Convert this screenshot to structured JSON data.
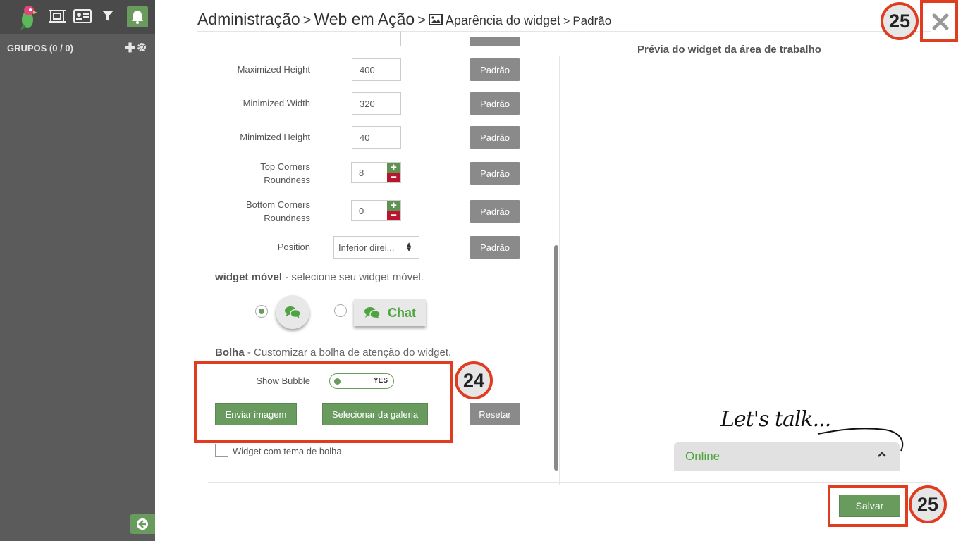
{
  "breadcrumb": {
    "admin": "Administração",
    "web_em_acao": "Web em Ação",
    "appearance": "Aparência do widget",
    "default": "Padrão",
    "sep": ">"
  },
  "sidebar": {
    "groups_label": "GRUPOS (0 / 0)"
  },
  "form": {
    "fields": [
      {
        "label": "Maximized Height",
        "value": "400",
        "button": "Padrão"
      },
      {
        "label": "Minimized Width",
        "value": "320",
        "button": "Padrão"
      },
      {
        "label": "Minimized Height",
        "value": "40",
        "button": "Padrão"
      }
    ],
    "top_corners": {
      "label1": "Top Corners",
      "label2": "Roundness",
      "value": "8",
      "button": "Padrão"
    },
    "bottom_corners": {
      "label1": "Bottom Corners",
      "label2": "Roundness",
      "value": "0",
      "button": "Padrão"
    },
    "position": {
      "label": "Position",
      "value": "Inferior direi...",
      "button": "Padrão"
    }
  },
  "mobile": {
    "title": "widget móvel",
    "subtitle": " - selecione seu widget móvel.",
    "chat_label": "Chat",
    "selected": "bubble"
  },
  "bubble": {
    "title": "Bolha",
    "subtitle": " - Customizar a bolha de atenção do widget.",
    "show_label": "Show Bubble",
    "toggle_value": "YES",
    "upload_button": "Enviar imagem",
    "gallery_button": "Selecionar da galeria",
    "reset_button": "Resetar",
    "theme_checkbox_label": "Widget com tema de bolha."
  },
  "preview": {
    "title": "Prévia do widget da área de trabalho",
    "tagline": "Let's talk...",
    "status": "Online"
  },
  "footer": {
    "save_button": "Salvar"
  },
  "annotations": {
    "badge_top": "25",
    "badge_bubble": "24",
    "badge_save": "25"
  },
  "colors": {
    "accent_green": "#6a9b5e",
    "highlight_red": "#e03c1f",
    "sidebar": "#5b5b5b"
  }
}
